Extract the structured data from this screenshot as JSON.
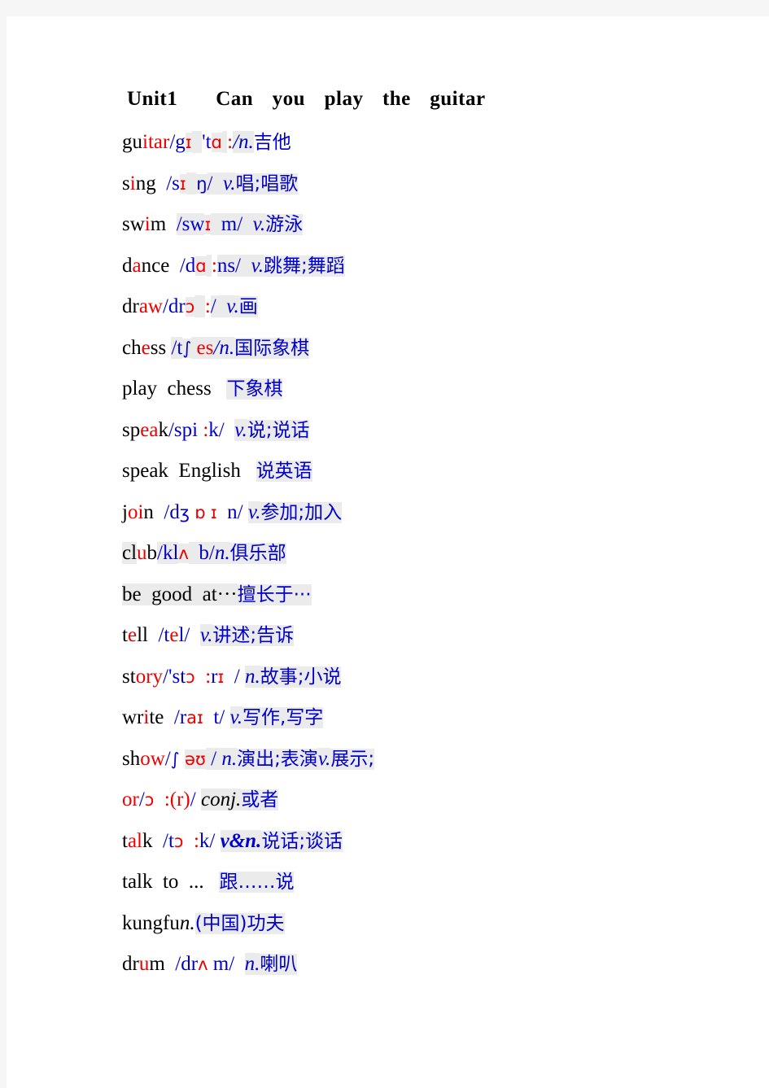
{
  "document": {
    "title": "Unit1    Can  you  play  the  guitar",
    "page_background": "#ffffff",
    "outer_background": "#f6f6f6",
    "colors": {
      "black": "#000000",
      "red": "#ee0000",
      "blue": "#0000cc",
      "highlight": "#ebebeb"
    }
  },
  "vocabulary": [
    {
      "id": "guitar",
      "word": "guitar",
      "phonetic": "/gɪ  'tɑ :/",
      "pos": "n.",
      "meaning": "吉他",
      "line": "guitar/gɪ  'tɑ :/n.吉他"
    },
    {
      "id": "sing",
      "word": "sing",
      "phonetic": "/sɪ  ŋ/",
      "pos": "v.",
      "meaning": "唱;唱歌",
      "line": "sing  /sɪ  ŋ/  v.唱;唱歌"
    },
    {
      "id": "swim",
      "word": "swim",
      "phonetic": "/swɪ  m/",
      "pos": "v.",
      "meaning": "游泳",
      "line": "swim  /swɪ  m/  v.游泳"
    },
    {
      "id": "dance",
      "word": "dance",
      "phonetic": "/dɑ :ns/",
      "pos": "v.",
      "meaning": "跳舞;舞蹈",
      "line": "dance  /dɑ :ns/  v.跳舞;舞蹈"
    },
    {
      "id": "draw",
      "word": "draw",
      "phonetic": "/drɔ  :/",
      "pos": "v.",
      "meaning": "画",
      "line": "draw/drɔ  :/  v.画"
    },
    {
      "id": "chess",
      "word": "chess",
      "phonetic": "/t∫ es/",
      "pos": "n.",
      "meaning": "国际象棋",
      "line": "chess /t∫ es/n.国际象棋"
    },
    {
      "id": "play-chess",
      "word": "play  chess",
      "phonetic": "",
      "pos": "",
      "meaning": "下象棋",
      "line": "play  chess   下象棋"
    },
    {
      "id": "speak",
      "word": "speak",
      "phonetic": "/spi :k/",
      "pos": "v.",
      "meaning": "说;说话",
      "line": "speak/spi :k/  v.说;说话"
    },
    {
      "id": "speak-english",
      "word": "speak  English",
      "phonetic": "",
      "pos": "",
      "meaning": "说英语",
      "line": "speak  English   说英语"
    },
    {
      "id": "join",
      "word": "join",
      "phonetic": "/dʒ ɒ ɪ  n/",
      "pos": "v.",
      "meaning": "参加;加入",
      "line": "join  /dʒ ɒ ɪ  n/  v.参加;加入"
    },
    {
      "id": "club",
      "word": "club",
      "phonetic": "/klʌ  b/",
      "pos": "n.",
      "meaning": "俱乐部",
      "line": "club/klʌ  b/n.俱乐部"
    },
    {
      "id": "be-good-at",
      "word": "be  good  at···",
      "phonetic": "",
      "pos": "",
      "meaning": "擅长于···",
      "line": "be  good  at···擅长于···"
    },
    {
      "id": "tell",
      "word": "tell",
      "phonetic": "/tel/",
      "pos": "v.",
      "meaning": "讲述;告诉",
      "line": "tell  /tel/  v.讲述;告诉"
    },
    {
      "id": "story",
      "word": "story",
      "phonetic": "/'stɔ  :rɪ  /",
      "pos": "n.",
      "meaning": "故事;小说",
      "line": "story/'stɔ  :rɪ  /  n.故事;小说"
    },
    {
      "id": "write",
      "word": "write",
      "phonetic": "/raɪ  t/",
      "pos": "v.",
      "meaning": "写作,写字",
      "line": "write  /raɪ  t/  v.写作,写字"
    },
    {
      "id": "show",
      "word": "show",
      "phonetic": "/∫ əʊ /",
      "pos": "n. / v.",
      "meaning": "演出;表演v.展示;",
      "line": "show/∫ əʊ /  n.演出;表演v.展示;"
    },
    {
      "id": "or",
      "word": "or",
      "phonetic": "/ɔ  :(r)/",
      "pos": "conj.",
      "meaning": "或者",
      "line": "or/ɔ  :(r)/  conj.或者"
    },
    {
      "id": "talk",
      "word": "talk",
      "phonetic": "/tɔ  :k/",
      "pos": "v&n.",
      "meaning": "说话;谈话",
      "line": "talk  /tɔ  :k/  v&n.说话;谈话"
    },
    {
      "id": "talk-to",
      "word": "talk  to  ...",
      "phonetic": "",
      "pos": "",
      "meaning": "跟……说",
      "line": "talk  to  ...   跟……说"
    },
    {
      "id": "kungfu",
      "word": "kungfu",
      "phonetic": "",
      "pos": "n.",
      "meaning": "(中国)功夫",
      "line": "kungfun.(中国)功夫"
    },
    {
      "id": "drum",
      "word": "drum",
      "phonetic": "/drʌ  m/",
      "pos": "n.",
      "meaning": "喇叭",
      "line": "drum  /drʌ  m/  n.喇叭"
    }
  ]
}
